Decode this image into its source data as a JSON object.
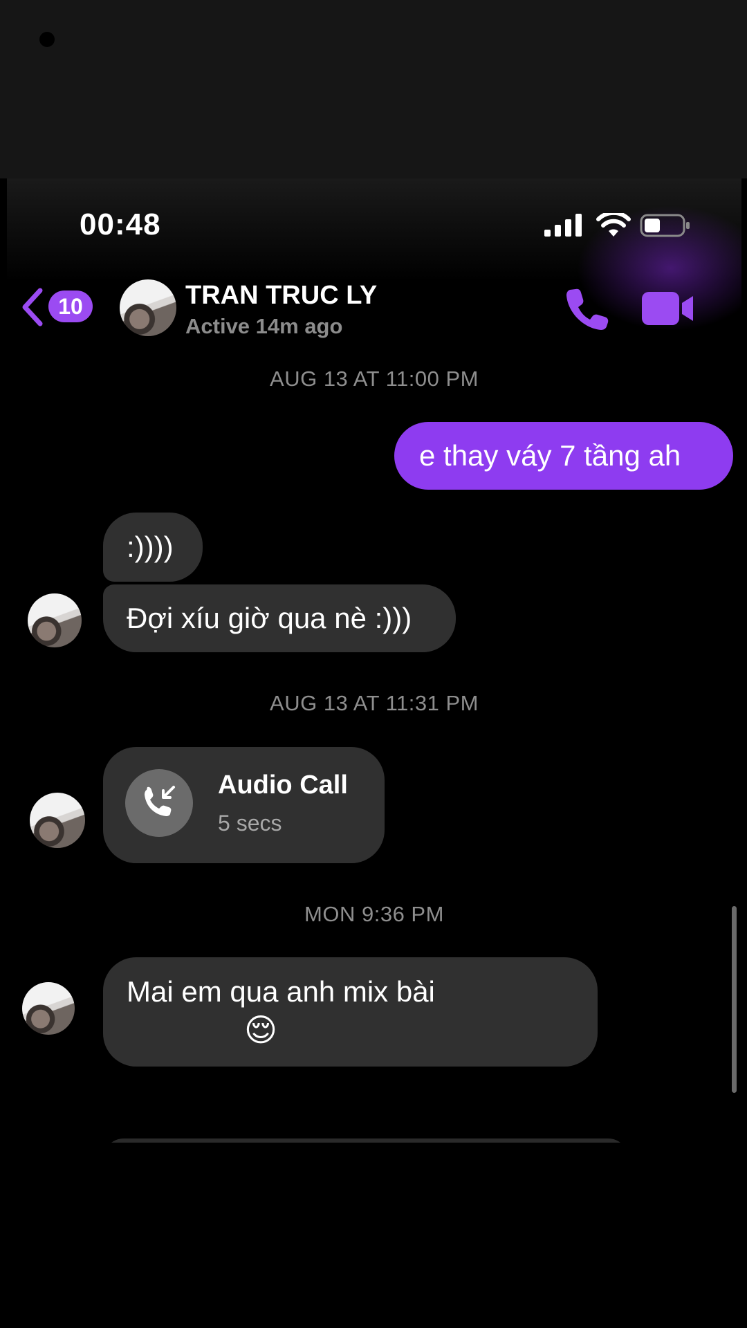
{
  "status_bar": {
    "time": "00:48"
  },
  "header": {
    "back_badge": "10",
    "contact_name": "TRAN TRUC LY",
    "contact_status": "Active 14m ago"
  },
  "colors": {
    "accent": "#8e3cf0",
    "incoming_bubble": "#303030",
    "background": "#000000"
  },
  "icons": [
    "back-chevron-icon",
    "phone-icon",
    "video-camera-icon",
    "signal-icon",
    "wifi-icon",
    "battery-icon",
    "incoming-call-icon"
  ],
  "messages": {
    "ts1": "AUG 13 AT 11:00 PM",
    "out1": "e thay váy 7 tầng ah",
    "in1": ":))))",
    "in2": "Đợi xíu giờ qua nè :)))",
    "ts2": "AUG 13 AT 11:31 PM",
    "call": {
      "title": "Audio Call",
      "duration": "5 secs"
    },
    "ts3": "MON 9:36 PM",
    "in3_line1": "Mai em qua anh mix bài",
    "in3_emoji": "😌"
  }
}
